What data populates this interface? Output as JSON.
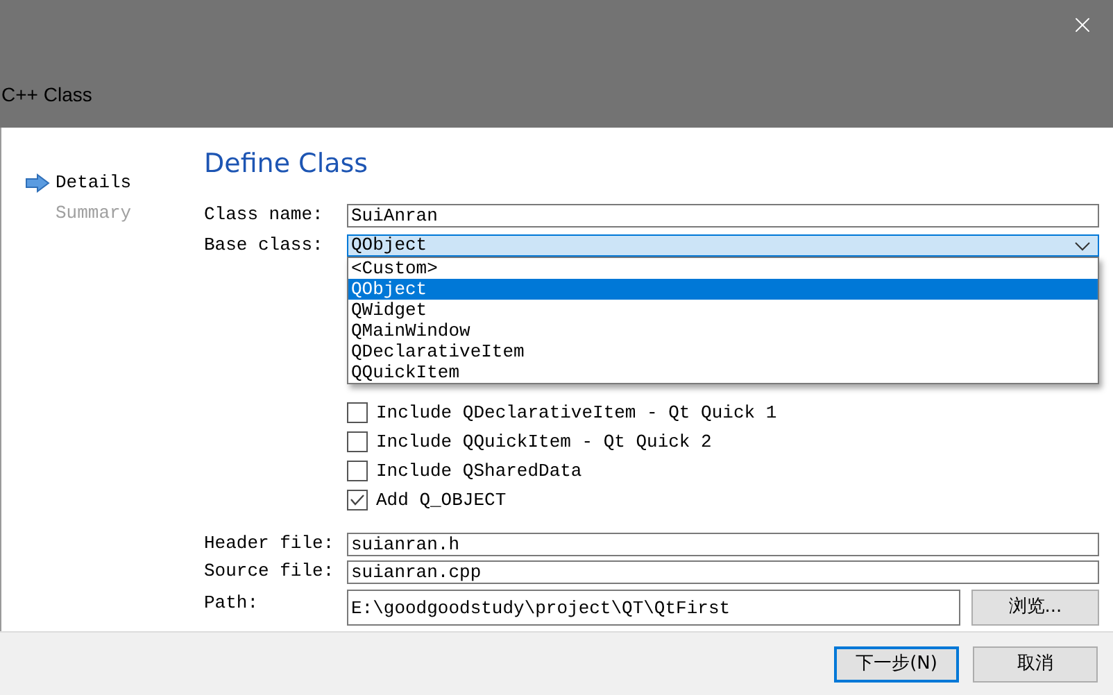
{
  "window": {
    "title": "C++ Class"
  },
  "steps": [
    {
      "label": "Details",
      "selected": true
    },
    {
      "label": "Summary",
      "selected": false
    }
  ],
  "page_title": "Define Class",
  "class_name": {
    "label": "Class name:",
    "value": "SuiAnran"
  },
  "base_class": {
    "label": "Base class:",
    "value": "QObject",
    "options": [
      {
        "label": "<Custom>",
        "selected": false
      },
      {
        "label": "QObject",
        "selected": true
      },
      {
        "label": "QWidget",
        "selected": false
      },
      {
        "label": "QMainWindow",
        "selected": false
      },
      {
        "label": "QDeclarativeItem",
        "selected": false
      },
      {
        "label": "QQuickItem",
        "selected": false
      }
    ]
  },
  "checkboxes": [
    {
      "label": "Include QDeclarativeItem - Qt Quick 1",
      "checked": false
    },
    {
      "label": "Include QQuickItem - Qt Quick 2",
      "checked": false
    },
    {
      "label": "Include QSharedData",
      "checked": false
    },
    {
      "label": "Add Q_OBJECT",
      "checked": true
    }
  ],
  "header_file": {
    "label": "Header file:",
    "value": "suianran.h"
  },
  "source_file": {
    "label": "Source file:",
    "value": "suianran.cpp"
  },
  "path": {
    "label": "Path:",
    "value": "E:\\goodgoodstudy\\project\\QT\\QtFirst",
    "button": "浏览..."
  },
  "buttons": [
    {
      "label": "下一步(N)",
      "kind": "default"
    },
    {
      "label": "取消",
      "kind": "normal"
    }
  ]
}
